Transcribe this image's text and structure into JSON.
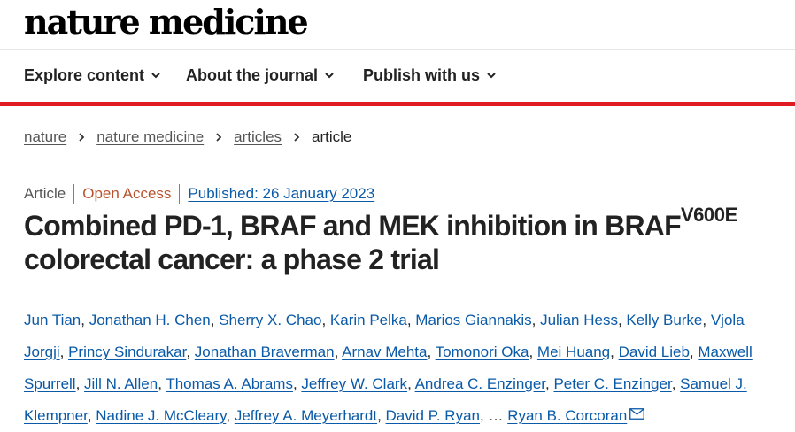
{
  "site": {
    "logo": "nature medicine"
  },
  "nav": [
    {
      "label": "Explore content"
    },
    {
      "label": "About the journal"
    },
    {
      "label": "Publish with us"
    }
  ],
  "breadcrumb": [
    {
      "label": "nature"
    },
    {
      "label": "nature medicine"
    },
    {
      "label": "articles"
    },
    {
      "label": "article"
    }
  ],
  "article": {
    "type": "Article",
    "access": "Open Access",
    "published": "Published: 26 January 2023",
    "title_main": "Combined PD-1, BRAF and MEK inhibition in BRAF",
    "title_sup": "V600E",
    "title_rest": " colorectal cancer: a phase 2 trial",
    "authors": [
      "Jun Tian",
      "Jonathan H. Chen",
      "Sherry X. Chao",
      "Karin Pelka",
      "Marios Giannakis",
      "Julian Hess",
      "Kelly Burke",
      "Vjola Jorgji",
      "Princy Sindurakar",
      "Jonathan Braverman",
      "Arnav Mehta",
      "Tomonori Oka",
      "Mei Huang",
      "David Lieb",
      "Maxwell Spurrell",
      "Jill N. Allen",
      "Thomas A. Abrams",
      "Jeffrey W. Clark",
      "Andrea C. Enzinger",
      "Peter C. Enzinger",
      "Samuel J. Klempner",
      "Nadine J. McCleary",
      "Jeffrey A. Meyerhardt",
      "David P. Ryan"
    ],
    "ellipsis": "…",
    "corresponding_author": "Ryan B. Corcoran"
  },
  "colors": {
    "accent_red": "#e01b22",
    "link_blue": "#0a5aa8",
    "open_access": "#b8532e"
  },
  "icons": {
    "nav_dropdown": "chevron-down-icon",
    "breadcrumb_sep": "chevron-right-icon",
    "contact": "mail-icon"
  }
}
